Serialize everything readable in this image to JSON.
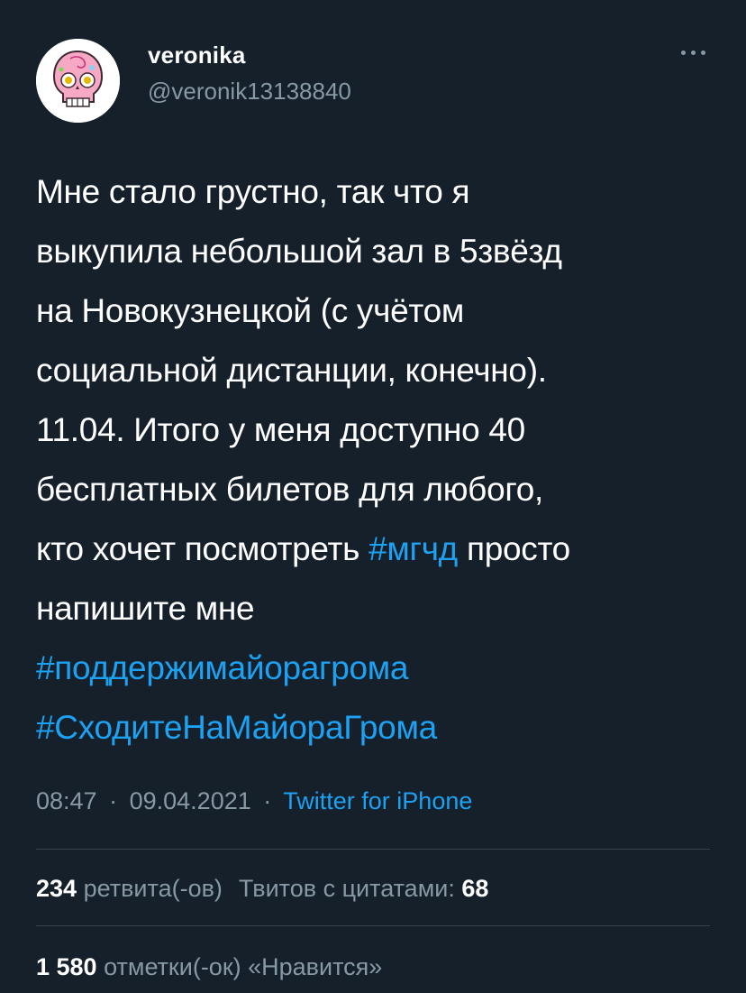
{
  "author": {
    "display_name": "veronika",
    "handle": "@veronik13138840",
    "avatar_icon": "pink-skull-avatar"
  },
  "more_icon": "ellipsis-icon",
  "tweet": {
    "lines": [
      [
        "Мне стало грустно, так что я"
      ],
      [
        "выкупила небольшой зал в 5звёзд"
      ],
      [
        "на Новокузнецкой (с учётом"
      ],
      [
        "социальной дистанции, конечно)."
      ],
      [
        "11.04. Итого у меня доступно 40"
      ],
      [
        "бесплатных билетов для любого,"
      ],
      [
        "кто хочет посмотреть ",
        "#мгчд",
        " просто"
      ],
      [
        "напишите мне"
      ],
      [
        "#поддержимайорагрома"
      ],
      [
        "#СходитеНаМайораГрома"
      ]
    ]
  },
  "meta": {
    "time": "08:47",
    "date": "09.04.2021",
    "separator": "·",
    "source": "Twitter for iPhone"
  },
  "stats": {
    "retweets_count": "234",
    "retweets_label": "ретвита(-ов)",
    "quotes_label": "Твитов с цитатами:",
    "quotes_count": "68",
    "likes_count": "1 580",
    "likes_label": "отметки(-ок) «Нравится»"
  },
  "colors": {
    "background": "#15202b",
    "link": "#1da1f2",
    "secondary_text": "#8899a6",
    "divider": "#38444d"
  }
}
